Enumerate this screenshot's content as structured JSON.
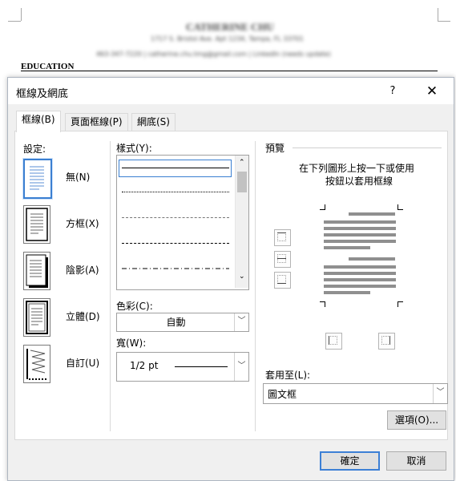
{
  "document": {
    "name_line": "CATHERINE CHU",
    "address_line": "1717 S. Bristol Ave. Apt 1234, Tampa, FL 33701",
    "contact_line": "463-347-7220 | catherine.chu.tmg@gmail.com | LinkedIn (needs update)",
    "section_heading": "EDUCATION"
  },
  "dialog": {
    "title": "框線及網底",
    "help_glyph": "?",
    "close_glyph": "✕",
    "tabs": [
      "框線(B)",
      "頁面框線(P)",
      "網底(S)"
    ],
    "settings": {
      "label": "設定:",
      "items": [
        "無(N)",
        "方框(X)",
        "陰影(A)",
        "立體(D)",
        "自訂(U)"
      ]
    },
    "style": {
      "label": "樣式(Y):",
      "line_styles": [
        "solid",
        "dotted",
        "dashed-fine",
        "dashed",
        "dash-dot"
      ]
    },
    "color": {
      "label": "色彩(C):",
      "value": "自動"
    },
    "width": {
      "label": "寬(W):",
      "value": "1/2 pt"
    },
    "preview": {
      "label": "預覽",
      "instruction_line1": "在下列圖形上按一下或使用",
      "instruction_line2": "按鈕以套用框線"
    },
    "apply_to": {
      "label": "套用至(L):",
      "value": "圖文框"
    },
    "options_label": "選項(O)...",
    "ok_label": "確定",
    "cancel_label": "取消"
  }
}
